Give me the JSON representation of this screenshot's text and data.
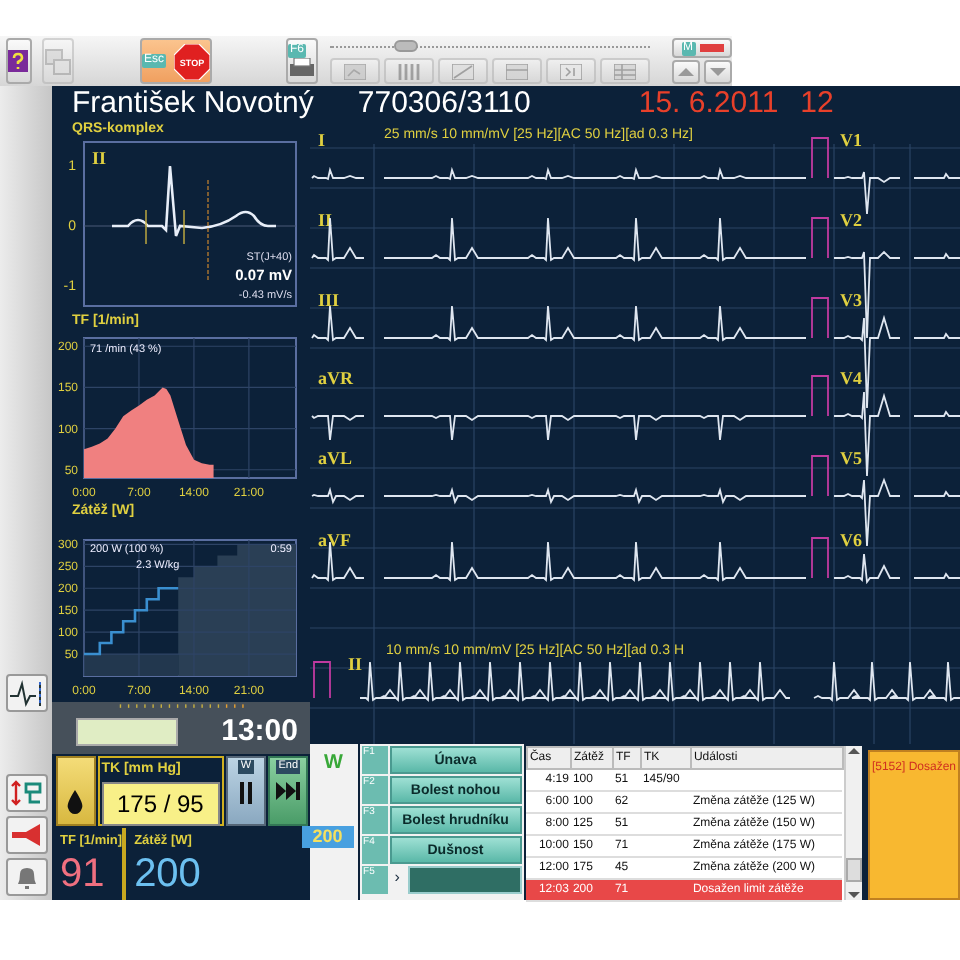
{
  "toolbar": {
    "items": [
      {
        "kind": "help",
        "disabled": false
      },
      {
        "kind": "copy",
        "disabled": true
      },
      {
        "kind": "stop",
        "key": "Esc",
        "label": "STOP",
        "disabled": false
      },
      {
        "kind": "print",
        "key": "F6",
        "disabled": false
      },
      {
        "kind": "tools",
        "slider": {
          "level": 0.2
        },
        "tools": [
          {
            "disabled": true
          },
          {
            "disabled": true
          },
          {
            "disabled": true
          },
          {
            "disabled": true
          },
          {
            "disabled": true
          },
          {
            "disabled": true
          }
        ]
      },
      {
        "kind": "marker",
        "key": "M",
        "disabled": false
      }
    ]
  },
  "header": {
    "patient": "František Novotný",
    "patient_id": "770306/3110",
    "date": "15. 6.2011",
    "time": "12"
  },
  "qrs": {
    "title": "QRS-komplex",
    "lead": "II",
    "yticks": [
      "1",
      "0",
      "-1"
    ],
    "st_label": "ST(J+40)",
    "st_value": "0.07 mV",
    "slope": "-0.43 mV/s"
  },
  "heart_rate": {
    "readout": "71 /min  (43 %)",
    "chart_data": {
      "type": "area",
      "title": "TF [1/min]",
      "x": [
        0,
        1,
        2,
        3,
        4,
        5,
        6,
        7,
        8,
        9,
        10,
        10.5,
        11,
        12,
        13,
        14,
        15,
        16,
        16.5
      ],
      "grid": true,
      "series": [
        {
          "color": "#f08080",
          "values": [
            75,
            78,
            82,
            88,
            100,
            115,
            122,
            128,
            135,
            140,
            150,
            148,
            140,
            110,
            80,
            62,
            58,
            56,
            56
          ]
        }
      ],
      "xlim": [
        0,
        27
      ],
      "ylim": [
        40,
        210
      ],
      "xticks": [
        {
          "value": 0,
          "label": "0:00"
        },
        {
          "value": 7,
          "label": "7:00"
        },
        {
          "value": 14,
          "label": "14:00"
        },
        {
          "value": 21,
          "label": "21:00"
        }
      ],
      "yticks": [
        50,
        100,
        150,
        200
      ]
    }
  },
  "load": {
    "readout": "200 W  (100 %)",
    "elapsed": "0:59",
    "per_kg": "2.3 W/kg",
    "chart_data": {
      "type": "line",
      "title": "Zátěž [W]",
      "x": [
        0,
        2,
        2,
        3.5,
        3.5,
        5,
        5,
        6.5,
        6.5,
        8,
        8,
        9.5,
        9.5,
        12
      ],
      "grid": true,
      "series": [
        {
          "color": "#3a8fd0",
          "values": [
            50,
            50,
            75,
            75,
            100,
            100,
            125,
            125,
            150,
            150,
            175,
            175,
            200,
            200
          ]
        }
      ],
      "xlim": [
        0,
        27
      ],
      "ylim": [
        0,
        310
      ],
      "xticks": [
        {
          "value": 0,
          "label": "0:00"
        },
        {
          "value": 7,
          "label": "7:00"
        },
        {
          "value": 14,
          "label": "14:00"
        },
        {
          "value": 21,
          "label": "21:00"
        }
      ],
      "yticks": [
        50,
        100,
        150,
        200,
        250,
        300
      ]
    }
  },
  "timer": {
    "time": "13:00"
  },
  "blood_pressure": {
    "title": "TK [mm Hg]",
    "value": "175 / 95",
    "pause_key": "W",
    "end_key": "End"
  },
  "vitals": [
    {
      "label": "TF [1/min]",
      "value": "91",
      "color": "#f07080"
    },
    {
      "label": "Zátěž [W]",
      "value": "200",
      "color": "#6cc0f0"
    }
  ],
  "ecg": {
    "settings": "25 mm/s  10 mm/mV  [25 Hz][AC 50 Hz][ad 0.3 Hz]",
    "limb_leads": [
      "I",
      "II",
      "III",
      "aVR",
      "aVL",
      "aVF"
    ],
    "chest_leads": [
      "V1",
      "V2",
      "V3",
      "V4",
      "V5",
      "V6"
    ],
    "rhythm": {
      "settings": "10 mm/s  10 mm/mV  [25 Hz][AC 50 Hz][ad 0.3 H",
      "lead": "II"
    }
  },
  "workload": {
    "label": "W",
    "value": "200"
  },
  "symptoms": [
    {
      "key": "F1",
      "label": "Únava"
    },
    {
      "key": "F2",
      "label": "Bolest nohou"
    },
    {
      "key": "F3",
      "label": "Bolest hrudníku"
    },
    {
      "key": "F4",
      "label": "Dušnost"
    },
    {
      "key": "F5",
      "arrow": "›"
    }
  ],
  "events": {
    "columns": [
      "Čas",
      "Zátěž",
      "TF",
      "TK",
      "Události"
    ],
    "rows": [
      {
        "time": "4:19",
        "load": "100",
        "hr": "51",
        "bp": "145/90",
        "selected": false
      },
      {
        "time": "6:00",
        "load": "100",
        "hr": "62",
        "event": "Změna zátěže (125 W)",
        "selected": false
      },
      {
        "time": "8:00",
        "load": "125",
        "hr": "51",
        "event": "Změna zátěže (150 W)",
        "selected": false
      },
      {
        "time": "10:00",
        "load": "150",
        "hr": "71",
        "event": "Změna zátěže (175 W)",
        "selected": false
      },
      {
        "time": "12:00",
        "load": "175",
        "hr": "45",
        "event": "Změna zátěže (200 W)",
        "selected": false
      },
      {
        "time": "12:03",
        "load": "200",
        "hr": "71",
        "event": "Dosažen limit zátěže",
        "selected": true
      }
    ]
  },
  "alert": {
    "text": "[5152] Dosažen"
  }
}
